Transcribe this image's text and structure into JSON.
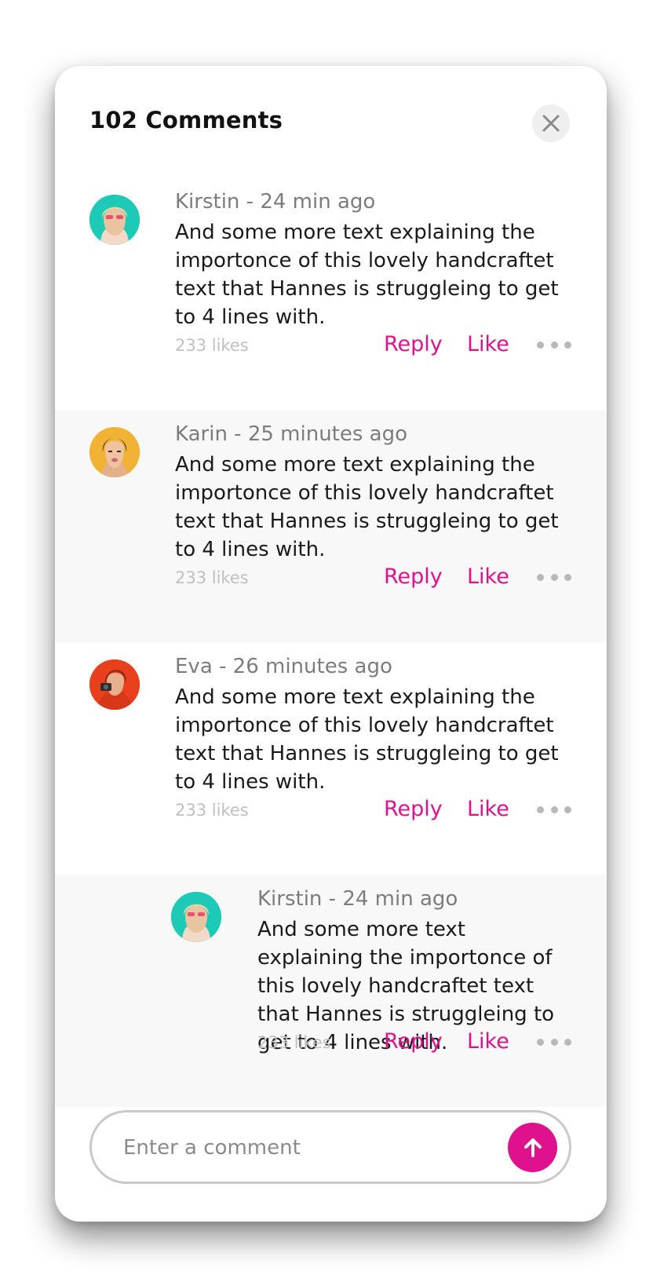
{
  "header": {
    "title": "102 Comments",
    "close_icon": "close-icon"
  },
  "comments": [
    {
      "author_line": "Kirstin - 24 min ago",
      "text": "And some more text explaining the importonce of this lovely handcraftet text that Hannes is struggleing to get to 4 lines with.",
      "likes": "233 likes",
      "reply_label": "Reply",
      "like_label": "Like",
      "avatar_color": "#1dc9b7"
    },
    {
      "author_line": "Karin - 25 minutes ago",
      "text": "And some more text explaining the importonce of this lovely handcraftet text that Hannes is struggleing to get to 4 lines with.",
      "likes": "233 likes",
      "reply_label": "Reply",
      "like_label": "Like",
      "avatar_color": "#f2b233"
    },
    {
      "author_line": "Eva - 26 minutes ago",
      "text": "And some more text explaining the importonce of this lovely handcraftet text that Hannes is struggleing to get to 4 lines with.",
      "likes": "233 likes",
      "reply_label": "Reply",
      "like_label": "Like",
      "avatar_color": "#e8401c"
    },
    {
      "author_line": "Kirstin - 24 min ago",
      "text": "And some more text explaining the importonce of this lovely handcraftet text that Hannes is struggleing to get to 4 lines with.",
      "likes": "233 likes",
      "reply_label": "Reply",
      "like_label": "Like",
      "avatar_color": "#1dc9b7"
    }
  ],
  "composer": {
    "placeholder": "Enter a comment",
    "value": "",
    "send_icon": "arrow-up-icon"
  },
  "colors": {
    "accent": "#e0118d",
    "alt_row_bg": "#f8f8f8"
  }
}
